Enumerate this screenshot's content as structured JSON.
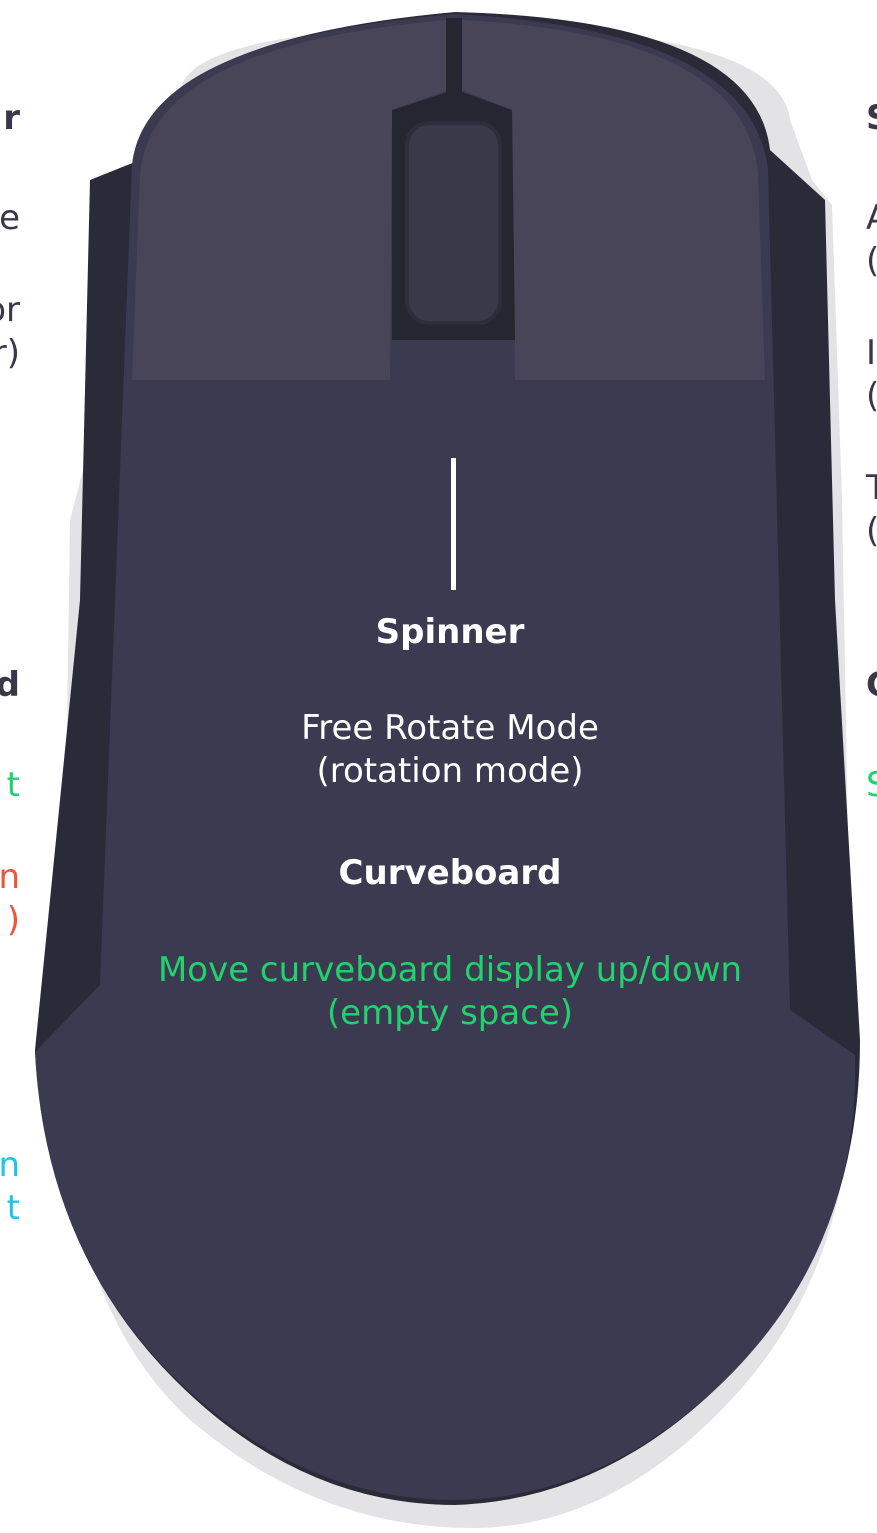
{
  "colors": {
    "shadow": "#e3e3e6",
    "body_dark": "#2b2a38",
    "body": "#3c3a50",
    "button": "#474557",
    "button_edge": "#2f2d3c",
    "wheel_well": "#262532",
    "wheel": "#3a394a",
    "accent_green": "#22d26e",
    "accent_red": "#f0543c",
    "accent_cyan": "#1cc6e6",
    "label_dark": "#3a3848",
    "label_light": "#ffffff"
  },
  "left_labels": {
    "heading_top": "r",
    "line_1": "e",
    "line_2a": "or",
    "line_2b": "r)",
    "heading_mid": "d",
    "green_line": "t",
    "red_line_a": "n",
    "red_line_b": ")",
    "cyan_line_a": "n",
    "cyan_line_b": "t"
  },
  "right_labels": {
    "heading_top": "S",
    "line_1a": "A",
    "line_1b": "(",
    "line_2a": "I",
    "line_2b": "(",
    "line_3a": "T",
    "line_3b": "(",
    "heading_mid": "C",
    "green_line": "S"
  },
  "center": {
    "spinner_heading": "Spinner",
    "spinner_line_1": "Free Rotate Mode",
    "spinner_line_2": "(rotation mode)",
    "curveboard_heading": "Curveboard",
    "curveboard_line_1": "Move curveboard display up/down",
    "curveboard_line_2": "(empty space)"
  }
}
